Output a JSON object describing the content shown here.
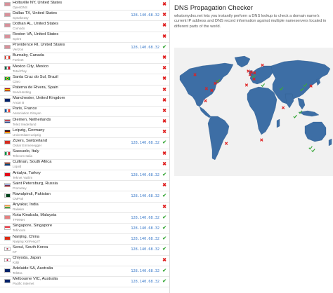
{
  "results": [
    {
      "city": "Holtsville NY, United States",
      "provider": "OpenDNS",
      "ip": "",
      "status": "fail",
      "flag": "us"
    },
    {
      "city": "Dallas TX, United States",
      "provider": "Speakeasy",
      "ip": "128.140.68.32",
      "status": "fail",
      "flag": "us"
    },
    {
      "city": "Dothan AL, United States",
      "provider": "Comodo",
      "ip": "",
      "status": "fail",
      "flag": "us"
    },
    {
      "city": "Reston VA, United States",
      "provider": "Sprint",
      "ip": "",
      "status": "fail",
      "flag": "us"
    },
    {
      "city": "Providence RI, United States",
      "provider": "Verizon",
      "ip": "128.140.68.32",
      "status": "ok",
      "flag": "us"
    },
    {
      "city": "Burnaby, Canada",
      "provider": "Fortinet",
      "ip": "",
      "status": "fail",
      "flag": "ca"
    },
    {
      "city": "Mexico City, Mexico",
      "provider": "Total Play",
      "ip": "",
      "status": "fail",
      "flag": "mx"
    },
    {
      "city": "Santa Cruz do Sul, Brazil",
      "provider": "Claro",
      "ip": "",
      "status": "fail",
      "flag": "br"
    },
    {
      "city": "Paterna de Rivera, Spain",
      "provider": "ServiHosting",
      "ip": "",
      "status": "fail",
      "flag": "es"
    },
    {
      "city": "Manchester, United Kingdom",
      "provider": "Ancar B",
      "ip": "",
      "status": "fail",
      "flag": "gb"
    },
    {
      "city": "Paris, France",
      "provider": "Association Gitoyen",
      "ip": "",
      "status": "fail",
      "flag": "fr"
    },
    {
      "city": "Diemen, Netherlands",
      "provider": "Tele2 Nederland",
      "ip": "",
      "status": "fail",
      "flag": "nl"
    },
    {
      "city": "Leipzig, Germany",
      "provider": "Universitaet Leipzig",
      "ip": "",
      "status": "fail",
      "flag": "de"
    },
    {
      "city": "Zizers, Switzerland",
      "provider": "Oskar Emmenegger",
      "ip": "128.140.68.32",
      "status": "ok",
      "flag": "ch"
    },
    {
      "city": "Sassuolo, Italy",
      "provider": "Telecom Italia",
      "ip": "",
      "status": "fail",
      "flag": "it"
    },
    {
      "city": "Cullinan, South Africa",
      "provider": "Liquid",
      "ip": "",
      "status": "fail",
      "flag": "za"
    },
    {
      "city": "Antalya, Turkey",
      "provider": "Teknet Yazlim",
      "ip": "128.140.68.32",
      "status": "ok",
      "flag": "tr"
    },
    {
      "city": "Saint Petersburg, Russia",
      "provider": "Prometey",
      "ip": "",
      "status": "fail",
      "flag": "ru"
    },
    {
      "city": "Rawalpindi, Pakistan",
      "provider": "CMPak",
      "ip": "128.140.68.32",
      "status": "ok",
      "flag": "pk"
    },
    {
      "city": "Anyakur, India",
      "provider": "Railwire",
      "ip": "",
      "status": "fail",
      "flag": "in"
    },
    {
      "city": "Kota Kinabalu, Malaysia",
      "provider": "TPMNet",
      "ip": "128.140.68.32",
      "status": "ok",
      "flag": "my"
    },
    {
      "city": "Singapore, Singapore",
      "provider": "Tefincom",
      "ip": "128.140.68.32",
      "status": "ok",
      "flag": "sg"
    },
    {
      "city": "Nanjing, China",
      "provider": "Nanjing XinFeng IT",
      "ip": "128.140.68.32",
      "status": "ok",
      "flag": "cn"
    },
    {
      "city": "Seoul, South Korea",
      "provider": "KT",
      "ip": "128.140.68.32",
      "status": "ok",
      "flag": "kr"
    },
    {
      "city": "Chiyoda, Japan",
      "provider": "Kddi",
      "ip": "",
      "status": "fail",
      "flag": "jp"
    },
    {
      "city": "Adelaide SA, Australia",
      "provider": "Telstra",
      "ip": "128.140.68.32",
      "status": "ok",
      "flag": "au"
    },
    {
      "city": "Melbourne VIC, Australia",
      "provider": "Pacific Internet",
      "ip": "128.140.68.32",
      "status": "ok",
      "flag": "au"
    }
  ],
  "panel": {
    "title": "DNS Propagation Checker",
    "description": "whatsmydns.net lets you instantly perform a DNS lookup to check a domain name's current IP address and DNS record information against multiple nameservers located in different parts of the world."
  },
  "map_markers": [
    {
      "label": "Burnaby",
      "lon": -123,
      "lat": 49,
      "status": "fail"
    },
    {
      "label": "Holtsville",
      "lon": -73,
      "lat": 41,
      "status": "fail"
    },
    {
      "label": "Providence",
      "lon": -71,
      "lat": 42,
      "status": "ok"
    },
    {
      "label": "Reston",
      "lon": -77,
      "lat": 39,
      "status": "fail"
    },
    {
      "label": "Dothan",
      "lon": -85,
      "lat": 31,
      "status": "fail"
    },
    {
      "label": "Dallas",
      "lon": -97,
      "lat": 33,
      "status": "fail"
    },
    {
      "label": "Mexico City",
      "lon": -99,
      "lat": 19,
      "status": "fail"
    },
    {
      "label": "Santa Cruz do Sul",
      "lon": -52,
      "lat": -30,
      "status": "fail"
    },
    {
      "label": "Paterna de Rivera",
      "lon": -6,
      "lat": 37,
      "status": "fail"
    },
    {
      "label": "Manchester",
      "lon": -2,
      "lat": 53,
      "status": "fail"
    },
    {
      "label": "Paris",
      "lon": 2,
      "lat": 49,
      "status": "fail"
    },
    {
      "label": "Diemen",
      "lon": 5,
      "lat": 52,
      "status": "fail"
    },
    {
      "label": "Leipzig",
      "lon": 12,
      "lat": 51,
      "status": "fail"
    },
    {
      "label": "Zizers",
      "lon": 10,
      "lat": 47,
      "status": "ok"
    },
    {
      "label": "Sassuolo",
      "lon": 11,
      "lat": 44,
      "status": "fail"
    },
    {
      "label": "Saint Petersburg",
      "lon": 30,
      "lat": 60,
      "status": "fail"
    },
    {
      "label": "Antalya",
      "lon": 31,
      "lat": 37,
      "status": "ok"
    },
    {
      "label": "Cullinan",
      "lon": 28,
      "lat": -26,
      "status": "fail"
    },
    {
      "label": "Rawalpindi",
      "lon": 73,
      "lat": 33,
      "status": "ok"
    },
    {
      "label": "Anyakur",
      "lon": 77,
      "lat": 11,
      "status": "fail"
    },
    {
      "label": "Kota Kinabalu",
      "lon": 116,
      "lat": 6,
      "status": "ok"
    },
    {
      "label": "Singapore",
      "lon": 104,
      "lat": 1,
      "status": "ok"
    },
    {
      "label": "Nanjing",
      "lon": 119,
      "lat": 32,
      "status": "ok"
    },
    {
      "label": "Seoul",
      "lon": 127,
      "lat": 37,
      "status": "ok"
    },
    {
      "label": "Chiyoda",
      "lon": 140,
      "lat": 36,
      "status": "fail"
    },
    {
      "label": "Adelaide",
      "lon": 139,
      "lat": -35,
      "status": "ok"
    },
    {
      "label": "Melbourne",
      "lon": 145,
      "lat": -38,
      "status": "ok"
    }
  ],
  "colors": {
    "ok": "#3aa83a",
    "fail": "#e02020",
    "ip": "#3a79c9",
    "land": "#3d6ea5",
    "map_bg": "#f1f1f1"
  },
  "icons": {
    "ok": "check-icon",
    "fail": "cross-icon"
  }
}
